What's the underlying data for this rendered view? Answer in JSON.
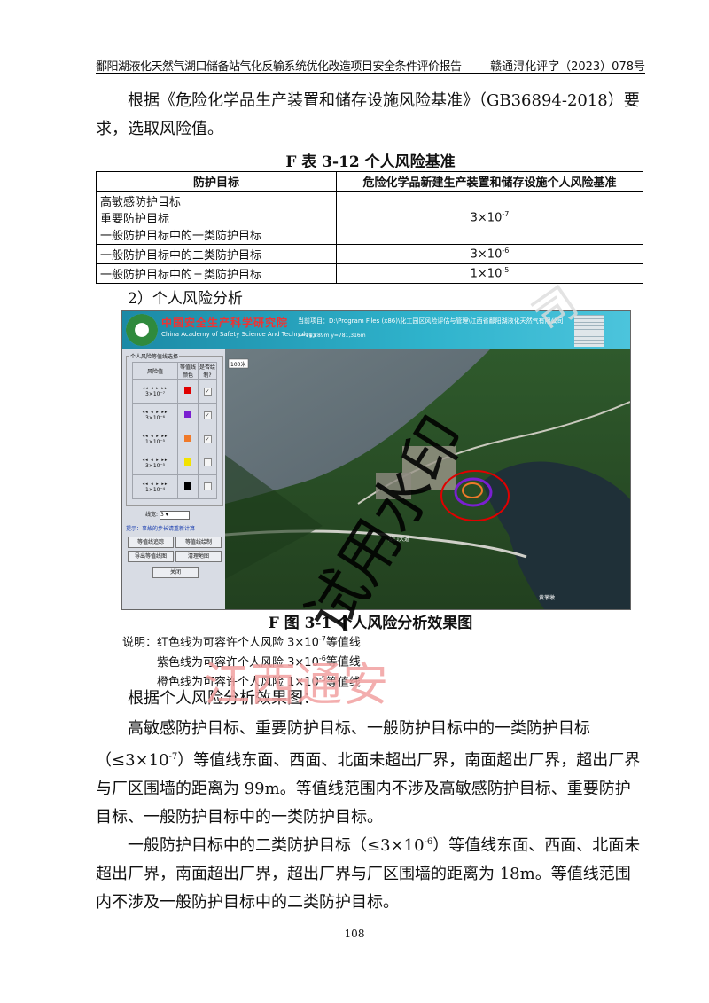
{
  "header": {
    "left": "鄱阳湖液化天然气湖口储备站气化反输系统优化改造项目安全条件评价报告",
    "right": "赣通浔化评字（2023）078号"
  },
  "intro": "根据《危险化学品生产装置和储存设施风险基准》（GB36894-2018）要求，选取风险值。",
  "table_caption": "F 表 3-12  个人风险基准",
  "table": {
    "headers": [
      "防护目标",
      "危险化学品新建生产装置和储存设施个人风险基准"
    ],
    "rows": [
      {
        "targets": [
          "高敏感防护目标",
          "重要防护目标",
          "一般防护目标中的一类防护目标"
        ],
        "base": "3×10",
        "exp": "-7"
      },
      {
        "targets": [
          "一般防护目标中的二类防护目标"
        ],
        "base": "3×10",
        "exp": "-6"
      },
      {
        "targets": [
          "一般防护目标中的三类防护目标"
        ],
        "base": "1×10",
        "exp": "-5"
      }
    ]
  },
  "section": "2）个人风险分析",
  "software": {
    "title_cn": "中国安全生产科学研究院",
    "title_en": "China Academy of Safety Science And Technology",
    "path": "当前项目：D:\\Program Files (x86)\\化工园区风险评估与管理\\江西省鄱阳湖液化天然气有限公司",
    "coord": "x=11,289m  y=781,316m",
    "panel_title": "个人风险等值线选择",
    "col_headers": [
      "风险值",
      "等值线颜色",
      "是否绘制?"
    ],
    "levels": [
      {
        "label": "3×10⁻⁷",
        "color": "#e00000",
        "checked": "✓"
      },
      {
        "label": "3×10⁻⁶",
        "color": "#7a1fd1",
        "checked": "✓"
      },
      {
        "label": "1×10⁻⁵",
        "color": "#f07a2a",
        "checked": "✓"
      },
      {
        "label": "3×10⁻⁵",
        "color": "#f2e200",
        "checked": ""
      },
      {
        "label": "1×10⁻⁴",
        "color": "#000000",
        "checked": ""
      }
    ],
    "arrows": "◂◂ ◂ ▸ ▸▸",
    "line_width_label": "线宽:",
    "line_width_value": "3",
    "hint": "提示：事故的步长请重新计算",
    "buttons": [
      "等值线追踪",
      "等值线绘制",
      "导出等值线图",
      "清理地图",
      "关闭"
    ],
    "scale": "100米",
    "map_labels": [
      "湖口大道",
      "黄茅墩"
    ]
  },
  "figure_caption": "F 图 3-1  个人风险分析效果图",
  "notes": {
    "prefix": "说明：",
    "lines": [
      {
        "pre": "红色线为可容许个人风险 3×10",
        "exp": "-7",
        "post": "等值线"
      },
      {
        "pre": "紫色线为可容许个人风险 3×10",
        "exp": "-6",
        "post": "等值线"
      },
      {
        "pre": "橙色线为可容许个人风险 1×10",
        "exp": "-5",
        "post": "等值线"
      }
    ]
  },
  "analysis_intro": "根据个人风险分析效果图：",
  "para1": {
    "line1": "高敏感防护目标、重要防护目标、一般防护目标中的一类防护目标",
    "pre": "（≤3×10",
    "exp": "-7",
    "post": "）等值线东面、西面、北面未超出厂界，南面超出厂界，超出厂界与厂区围墙的距离为 99m。等值线范围内不涉及高敏感防护目标、重要防护目标、一般防护目标中的一类防护目标。"
  },
  "para2": {
    "pre": "一般防护目标中的二类防护目标（≤3×10",
    "exp": "-6",
    "post": "）等值线东面、西面、北面未超出厂界，南面超出厂界，超出厂界与厂区围墙的距离为 18m。等值线范围内不涉及一般防护目标中的二类防护目标。"
  },
  "page_number": "108",
  "watermarks": {
    "main": "试用水印",
    "company": "江西通安",
    "corner": "司"
  },
  "colors": {
    "red_line": "#e00000",
    "purple_line": "#7a1fd1",
    "orange_line": "#f07a2a",
    "watermark_red": "#f2a0a0"
  }
}
